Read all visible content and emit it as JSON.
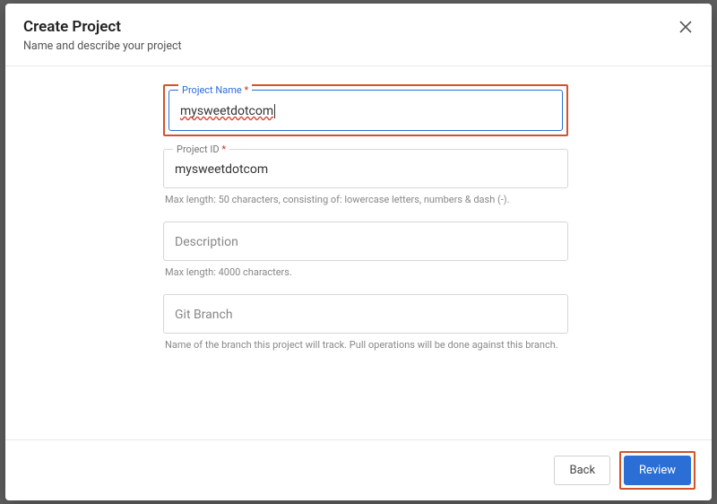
{
  "modal": {
    "title": "Create Project",
    "subtitle": "Name and describe your project"
  },
  "fields": {
    "projectName": {
      "label": "Project Name",
      "required": "*",
      "value": "mysweetdotcom"
    },
    "projectId": {
      "label": "Project ID",
      "required": "*",
      "value": "mysweetdotcom",
      "helper": "Max length: 50 characters, consisting of: lowercase letters, numbers & dash (-)."
    },
    "description": {
      "placeholder": "Description",
      "value": "",
      "helper": "Max length: 4000 characters."
    },
    "gitBranch": {
      "placeholder": "Git Branch",
      "value": "",
      "helper": "Name of the branch this project will track. Pull operations will be done against this branch."
    }
  },
  "footer": {
    "back": "Back",
    "review": "Review"
  }
}
